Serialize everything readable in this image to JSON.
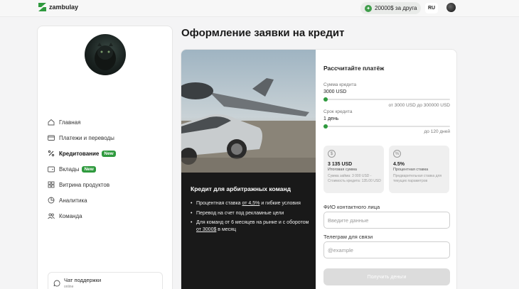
{
  "topbar": {
    "logo_text": "zambulay",
    "promo_text": "20000$ за друга",
    "promo_icon": "gift-icon",
    "lang": "RU"
  },
  "sidebar": {
    "items": [
      {
        "label": "Главная",
        "icon": "home-icon"
      },
      {
        "label": "Платежи и переводы",
        "icon": "card-icon"
      },
      {
        "label": "Кредитование",
        "icon": "percent-icon",
        "badge": "New",
        "active": true
      },
      {
        "label": "Вклады",
        "icon": "wallet-icon",
        "badge": "New"
      },
      {
        "label": "Витрина продуктов",
        "icon": "grid-icon"
      },
      {
        "label": "Аналитика",
        "icon": "analytics-icon"
      },
      {
        "label": "Команда",
        "icon": "team-icon"
      }
    ],
    "support": {
      "title": "Чат поддержки",
      "status": "online"
    }
  },
  "main": {
    "title": "Оформление заявки на кредит",
    "offer": {
      "title": "Кредит для арбитражных команд",
      "bullet1_pre": "Процентная ставка ",
      "bullet1_link": "от 4,5%",
      "bullet1_post": " и гибкие условия",
      "bullet2": "Перевод на счет под рекламные цели",
      "bullet3_pre": "Для команд от 6 месяцев на рынке и с оборотом ",
      "bullet3_link": "от 3000$",
      "bullet3_post": " в месяц"
    },
    "calculator": {
      "title": "Рассчитайте платёж",
      "amount_label": "Сумма кредита",
      "amount_value": "3000 USD",
      "amount_position": 0,
      "amount_range": "от 3000 USD до 300000 USD",
      "term_label": "Срок кредита",
      "term_value": "1 день",
      "term_position": 0,
      "term_range": "до 120 дней",
      "total": {
        "icon": "dollar-icon",
        "value": "3 135 USD",
        "label": "Итоговая сумма",
        "desc": "Сумма займа: 3 000 USD - Стоимость кредита: 135.00 USD"
      },
      "rate": {
        "icon": "percent-icon",
        "value": "4.5%",
        "label": "Процентная ставка",
        "desc": "Предварительная ставка для текущих параметров"
      }
    },
    "form": {
      "name_label": "ФИО контактного лица",
      "name_placeholder": "Введите данные",
      "telegram_label": "Телеграм для связи",
      "telegram_placeholder": "@example",
      "submit_label": "Получить деньги"
    }
  },
  "colors": {
    "accent": "#2f9a3e",
    "dark_panel": "#191919",
    "page_bg": "#f4f4f5"
  }
}
